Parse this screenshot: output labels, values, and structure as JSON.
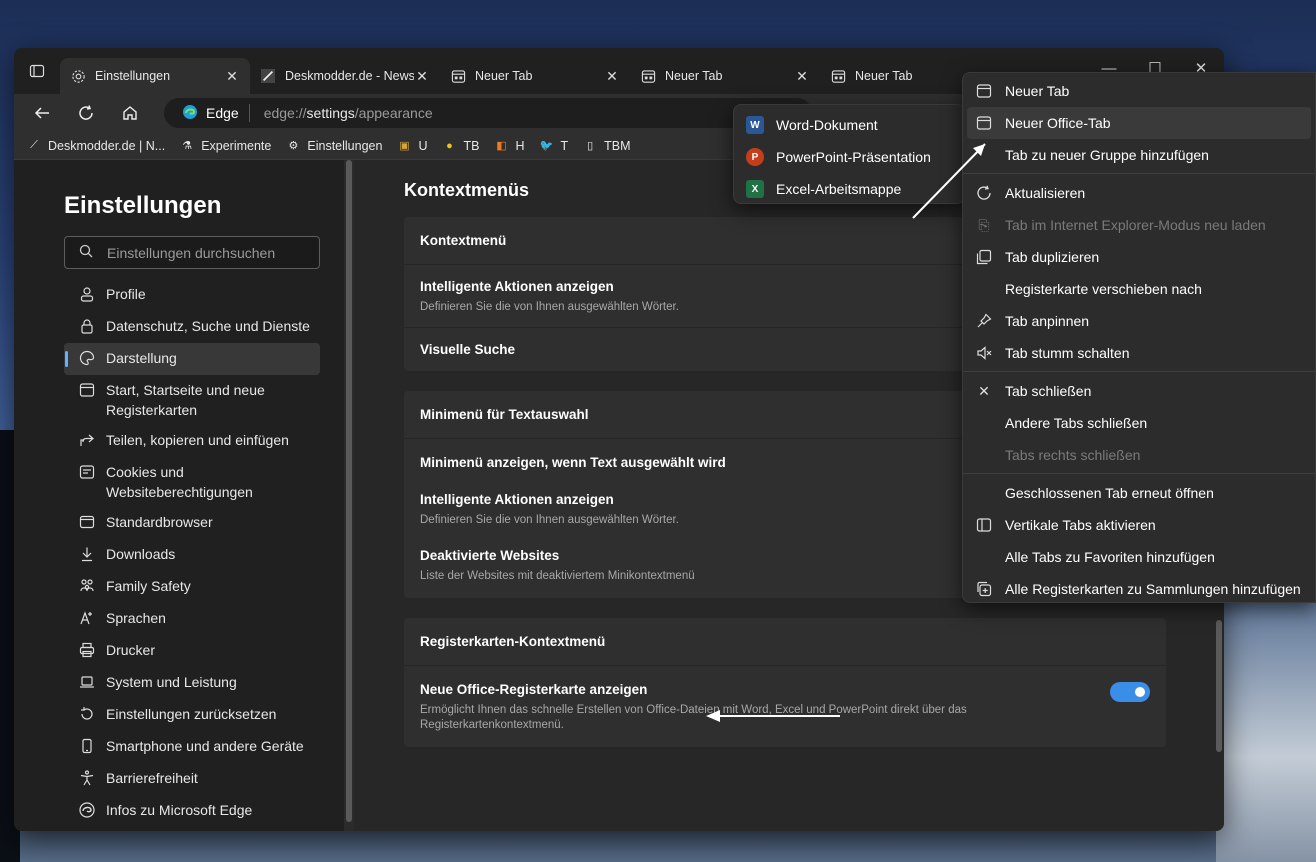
{
  "tabs": [
    {
      "title": "Einstellungen",
      "active": true
    },
    {
      "title": "Deskmodder.de - News",
      "active": false
    },
    {
      "title": "Neuer Tab",
      "active": false
    },
    {
      "title": "Neuer Tab",
      "active": false
    },
    {
      "title": "Neuer Tab",
      "active": false
    }
  ],
  "address": {
    "site": "Edge",
    "url_prefix": "edge://",
    "url_main": "settings",
    "url_suffix": "/appearance"
  },
  "favorites": [
    "Deskmodder.de | N...",
    "Experimente",
    "Einstellungen",
    "U",
    "TB",
    "H",
    "T",
    "TBM"
  ],
  "sidebar": {
    "title": "Einstellungen",
    "search_placeholder": "Einstellungen durchsuchen",
    "items": [
      {
        "label": "Profile"
      },
      {
        "label": "Datenschutz, Suche und Dienste"
      },
      {
        "label": "Darstellung",
        "active": true
      },
      {
        "label": "Start, Startseite und neue Registerkarten"
      },
      {
        "label": "Teilen, kopieren und einfügen"
      },
      {
        "label": "Cookies und Websiteberechtigungen"
      },
      {
        "label": "Standardbrowser"
      },
      {
        "label": "Downloads"
      },
      {
        "label": "Family Safety"
      },
      {
        "label": "Sprachen"
      },
      {
        "label": "Drucker"
      },
      {
        "label": "System und Leistung"
      },
      {
        "label": "Einstellungen zurücksetzen"
      },
      {
        "label": "Smartphone und andere Geräte"
      },
      {
        "label": "Barrierefreiheit"
      },
      {
        "label": "Infos zu Microsoft Edge"
      }
    ]
  },
  "main": {
    "section_title": "Kontextmenüs",
    "card1": {
      "header": "Kontextmenü",
      "row1_title": "Intelligente Aktionen anzeigen",
      "row1_desc": "Definieren Sie die von Ihnen ausgewählten Wörter.",
      "row2_title": "Visuelle Suche"
    },
    "card2": {
      "header": "Minimenü für Textauswahl",
      "row1_title": "Minimenü anzeigen, wenn Text ausgewählt wird",
      "row2_title": "Intelligente Aktionen anzeigen",
      "row2_desc": "Definieren Sie die von Ihnen ausgewählten Wörter.",
      "row3_title": "Deaktivierte Websites",
      "row3_desc": "Liste der Websites mit deaktiviertem Minikontextmenü"
    },
    "card3": {
      "header": "Registerkarten-Kontextmenü",
      "row1_title": "Neue Office-Registerkarte anzeigen",
      "row1_desc": "Ermöglicht Ihnen das schnelle Erstellen von Office-Dateien mit Word, Excel und PowerPoint direkt über das Registerkartenkontextmenü.",
      "toggle_on": true
    }
  },
  "office_menu": [
    "Word-Dokument",
    "PowerPoint-Präsentation",
    "Excel-Arbeitsmappe"
  ],
  "context_menu": {
    "new_tab": "Neuer Tab",
    "new_office_tab": "Neuer Office-Tab",
    "add_to_group": "Tab zu neuer Gruppe hinzufügen",
    "refresh": "Aktualisieren",
    "ie_mode": "Tab im Internet Explorer-Modus neu laden",
    "duplicate": "Tab duplizieren",
    "move_to": "Registerkarte verschieben nach",
    "pin": "Tab anpinnen",
    "mute": "Tab stumm schalten",
    "close": "Tab schließen",
    "close_others": "Andere Tabs schließen",
    "close_right": "Tabs rechts schließen",
    "reopen": "Geschlossenen Tab erneut öffnen",
    "vertical": "Vertikale Tabs aktivieren",
    "add_favorites": "Alle Tabs zu Favoriten hinzufügen",
    "add_collections": "Alle Registerkarten zu Sammlungen hinzufügen"
  },
  "colors": {
    "accent": "#3b8ee8",
    "word": "#2b5797",
    "powerpoint": "#c43e1c",
    "excel": "#1f7244"
  }
}
